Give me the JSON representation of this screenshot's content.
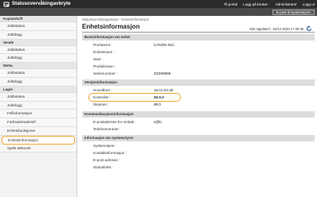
{
  "header": {
    "title": "Statusovervåkingavbryte",
    "links": [
      "Til portal",
      "Logg på bruker :",
      "Administrator",
      "Logg ut"
    ],
    "mail_button": "E-post til systemstyrer"
  },
  "sidebar": {
    "sections": [
      {
        "title": "Kopiutskrift",
        "items": [
          "Jobbstatus",
          "Jobblogg"
        ]
      },
      {
        "title": "Sende",
        "items": [
          "Jobbstatus",
          "Jobblogg"
        ]
      },
      {
        "title": "Motta",
        "items": [
          "Jobbstatus",
          "Jobblogg"
        ]
      },
      {
        "title": "Lagre",
        "items": [
          "Jobbstatus",
          "Jobblogg",
          "Fellinformasjon",
          "Forbruksmateriell",
          "Enhetsfunksjoner",
          "Enhetsinformasjon",
          "Sjekk telleverk"
        ]
      }
    ],
    "active": "Enhetsinformasjon"
  },
  "main": {
    "breadcrumb": "Statusovervåkingavbryte : Enhetsinformasjon",
    "title": "Enhetsinformasjon",
    "updated": "Sist oppdatert : 04/12 2020 17:35:38",
    "sections": [
      {
        "title": "Basisinformasjon om enhet",
        "rows": [
          {
            "label": "Produsent :",
            "value": "CANON INC."
          },
          {
            "label": "Enhetsnavn :",
            "value": ""
          },
          {
            "label": "Sted :",
            "value": ""
          },
          {
            "label": "Produktnavn :",
            "value": ""
          },
          {
            "label": "Serienummer :",
            "value": "ZZZ99999"
          }
        ]
      },
      {
        "title": "Versjoninformasjon",
        "rows": [
          {
            "label": "Hovedkort :",
            "value": "16.01.04.38"
          },
          {
            "label": "Kontroller :",
            "value": "20.0.0"
          },
          {
            "label": "Skanner :",
            "value": "99.0"
          }
        ]
      },
      {
        "title": "Kommunikasjonsinformasjon",
        "rows": [
          {
            "label": "E-postadresse for mottak :",
            "value": "e@b"
          },
          {
            "label": "Telefonnummer :",
            "value": ""
          }
        ]
      },
      {
        "title": "Informasjon om systemstyrer",
        "rows": [
          {
            "label": "Systemstyrer :",
            "value": ""
          },
          {
            "label": "Kontaktinformasjon :",
            "value": ""
          },
          {
            "label": "E-post adresse :",
            "value": ""
          },
          {
            "label": "Statusboks :",
            "value": ""
          }
        ]
      }
    ]
  },
  "colors": {
    "accent": "#f0a830",
    "topbar": "#2b2b2b",
    "subbar": "#4a4a4a"
  }
}
